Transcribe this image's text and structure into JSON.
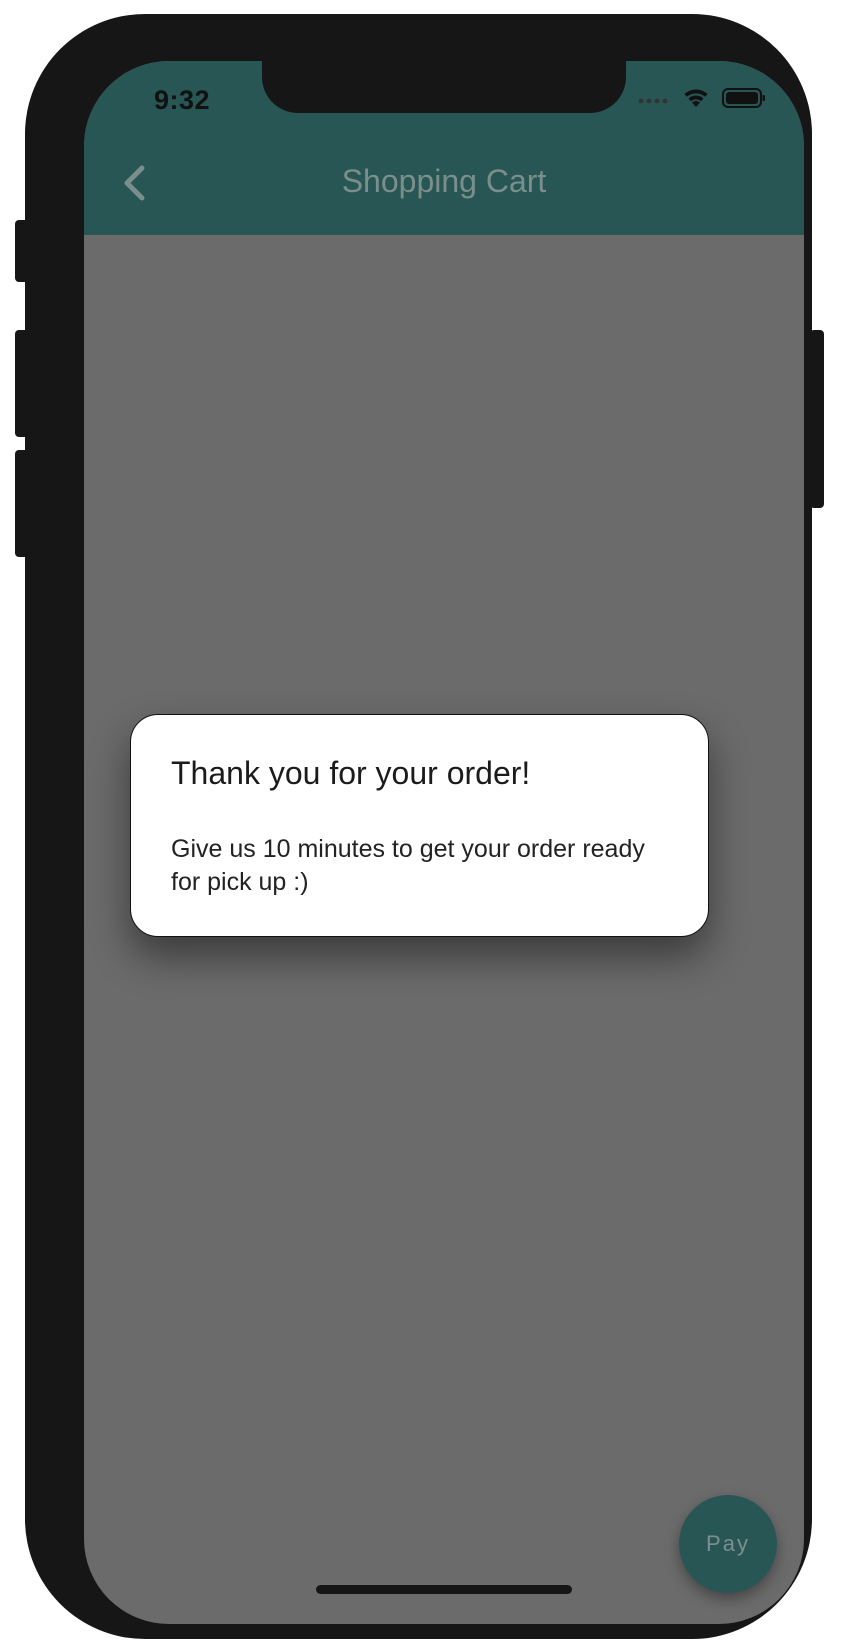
{
  "status_bar": {
    "time": "9:32",
    "signal_icon": "cellular-dots-icon",
    "wifi_icon": "wifi-icon",
    "battery_icon": "battery-icon"
  },
  "app_bar": {
    "back_icon": "chevron-left-icon",
    "title": "Shopping Cart",
    "color": "#275654"
  },
  "dialog": {
    "title": "Thank you for your order!",
    "message": "Give us 10 minutes to get your order ready for pick up :)"
  },
  "fab": {
    "label": "Pay"
  },
  "colors": {
    "scrim": "#6b6b6b",
    "accent": "#275654",
    "dialog_background": "#ffffff"
  }
}
